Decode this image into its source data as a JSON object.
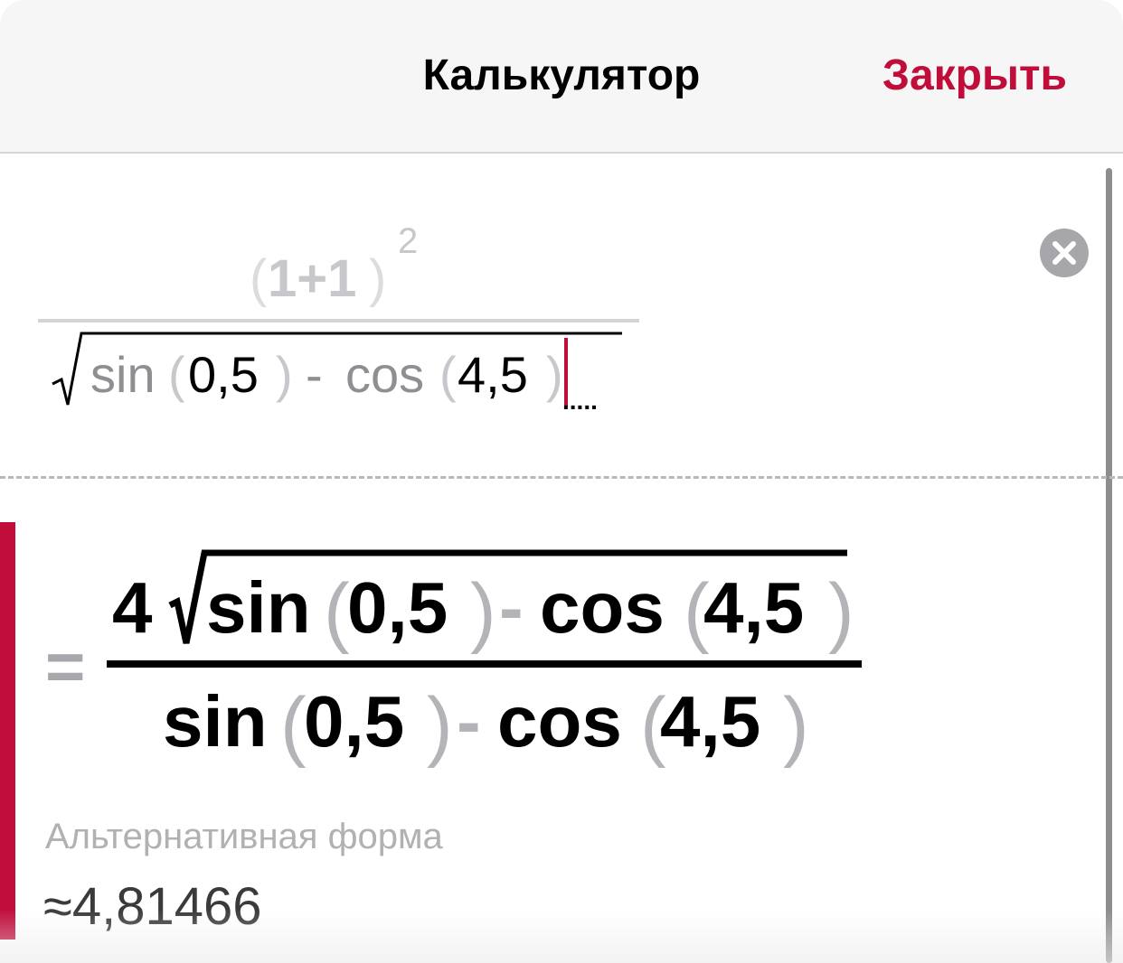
{
  "header": {
    "title": "Калькулятор",
    "close_label": "Закрыть"
  },
  "input_expression": {
    "numerator_open": "(",
    "numerator_body": "1+1",
    "numerator_close": ")",
    "exponent": "2",
    "sqrt_fn1": "sin",
    "sqrt_arg1_open": "(",
    "sqrt_arg1": "0,5",
    "sqrt_arg1_close": ")",
    "minus": "-",
    "sqrt_fn2": "cos",
    "sqrt_arg2_open": "(",
    "sqrt_arg2": "4,5",
    "sqrt_arg2_close": ")",
    "placeholder": "....."
  },
  "result": {
    "equals": "=",
    "num_coef": "4",
    "num_fn1": "sin",
    "num_arg1": "0,5",
    "num_minus": "-",
    "num_fn2": "cos",
    "num_arg2": "4,5",
    "den_fn1": "sin",
    "den_arg1": "0,5",
    "den_minus": "-",
    "den_fn2": "cos",
    "den_arg2": "4,5",
    "paren_open": "(",
    "paren_close": ")"
  },
  "alternative": {
    "label": "Альтернативная форма",
    "approx_sign": "≈",
    "value": "4,81466"
  },
  "colors": {
    "accent": "#c00d3a",
    "faded_text": "#c7c7cc",
    "gray_text": "#8e8e93"
  },
  "icons": {
    "clear": "clear-circle-icon",
    "sqrt": "sqrt-sign-icon"
  }
}
